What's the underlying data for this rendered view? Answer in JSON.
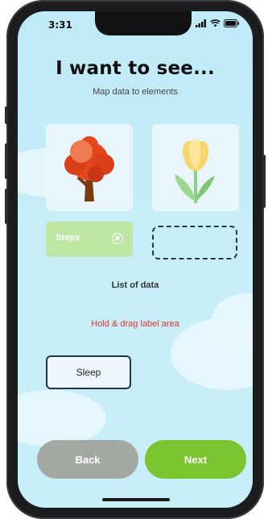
{
  "status_bar": {
    "time": "3:31",
    "icons": [
      "signal-icon",
      "wifi-icon",
      "battery-icon"
    ]
  },
  "header": {
    "title": "I want to see...",
    "subtitle": "Map data to elements"
  },
  "cards": [
    {
      "name": "tree",
      "icon": "tree-icon"
    },
    {
      "name": "tulip",
      "icon": "tulip-icon"
    }
  ],
  "mapped_label": {
    "text": "Steps",
    "remove_icon": "close-circle-icon"
  },
  "list_title": "List of data",
  "hint": "Hold & drag label area",
  "data_items": [
    {
      "label": "Sleep"
    }
  ],
  "footer": {
    "back_label": "Back",
    "next_label": "Next"
  },
  "colors": {
    "background": "#c4ecf8",
    "chip": "#bde6a3",
    "next": "#7ac52f",
    "back": "#a3aaa2",
    "hint": "#e0332b",
    "border": "#22364a"
  }
}
